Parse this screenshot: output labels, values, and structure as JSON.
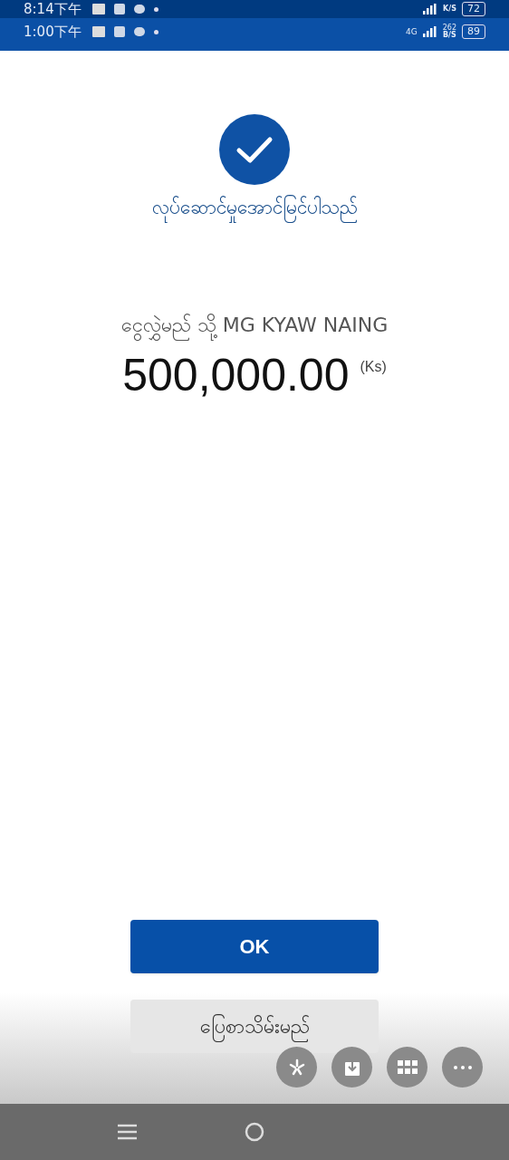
{
  "status_bars": [
    {
      "time": "8:14下午",
      "speed_unit": "K/S",
      "battery": "72"
    },
    {
      "time": "1:00下午",
      "network": "4G",
      "speed_value": "262",
      "speed_unit": "B/S",
      "battery": "89"
    }
  ],
  "result": {
    "title": "လုပ်ဆောင်မှုအောင်မြင်ပါသည်",
    "recipient": "ငွေလွှဲမည် သို့ MG KYAW NAING",
    "amount": "500,000.00",
    "currency": "(Ks)"
  },
  "buttons": [
    {
      "label": "OK",
      "kind": "primary"
    },
    {
      "label": "ပြေစာသိမ်းမည်",
      "kind": "secondary"
    }
  ]
}
